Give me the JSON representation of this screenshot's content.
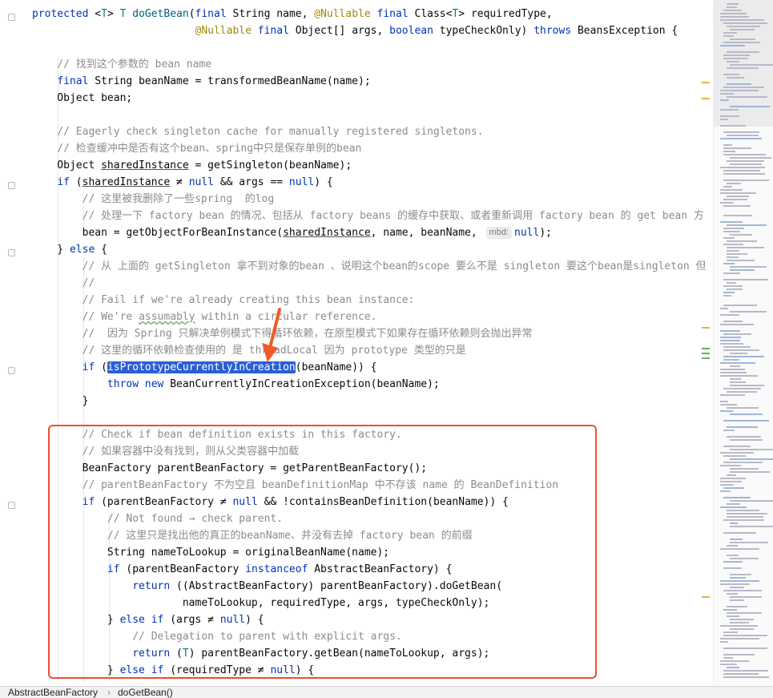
{
  "editor": {
    "lines": [
      {
        "seg": [
          {
            "t": "protected ",
            "c": "kw"
          },
          {
            "t": "<"
          },
          {
            "t": "T",
            "c": "tp"
          },
          {
            "t": "> "
          },
          {
            "t": "T",
            "c": "tp"
          },
          {
            "t": " "
          },
          {
            "t": "doGetBean",
            "c": "fn"
          },
          {
            "t": "("
          },
          {
            "t": "final ",
            "c": "kw"
          },
          {
            "t": "String name, "
          },
          {
            "t": "@Nullable ",
            "c": "ann"
          },
          {
            "t": "final ",
            "c": "kw"
          },
          {
            "t": "Class<"
          },
          {
            "t": "T",
            "c": "tp"
          },
          {
            "t": "> requiredType,"
          }
        ]
      },
      {
        "seg": [
          {
            "t": "                          "
          },
          {
            "t": "@Nullable ",
            "c": "ann"
          },
          {
            "t": "final ",
            "c": "kw"
          },
          {
            "t": "Object[] args, "
          },
          {
            "t": "boolean ",
            "c": "kw"
          },
          {
            "t": "typeCheckOnly) "
          },
          {
            "t": "throws ",
            "c": "kw"
          },
          {
            "t": "BeansException {"
          }
        ]
      },
      {
        "seg": []
      },
      {
        "seg": [
          {
            "t": "    // 找到这个参数的 bean name",
            "c": "cm"
          }
        ]
      },
      {
        "seg": [
          {
            "t": "    "
          },
          {
            "t": "final ",
            "c": "kw"
          },
          {
            "t": "String beanName = transformedBeanName(name);"
          }
        ]
      },
      {
        "seg": [
          {
            "t": "    Object bean;"
          }
        ]
      },
      {
        "seg": []
      },
      {
        "seg": [
          {
            "t": "    // Eagerly check singleton cache for manually registered singletons.",
            "c": "cm"
          }
        ]
      },
      {
        "seg": [
          {
            "t": "    // 检查缓冲中是否有这个bean、spring中只是保存单例的bean",
            "c": "cm"
          }
        ]
      },
      {
        "seg": [
          {
            "t": "    Object "
          },
          {
            "t": "sharedInstance",
            "c": "und"
          },
          {
            "t": " = getSingleton(beanName);"
          }
        ]
      },
      {
        "seg": [
          {
            "t": "    "
          },
          {
            "t": "if ",
            "c": "kw"
          },
          {
            "t": "("
          },
          {
            "t": "sharedInstance",
            "c": "und"
          },
          {
            "t": " ≠ "
          },
          {
            "t": "null ",
            "c": "kw"
          },
          {
            "t": "&& args == "
          },
          {
            "t": "null",
            "c": "kw"
          },
          {
            "t": ") {"
          }
        ]
      },
      {
        "seg": [
          {
            "t": "        // 这里被我删除了一些spring  的log",
            "c": "cm"
          }
        ]
      },
      {
        "seg": [
          {
            "t": "        // 处理一下 factory bean 的情况、包括从 factory beans 的缓存中获取、或者重新调用 factory bean 的 get bean 方",
            "c": "cm"
          }
        ]
      },
      {
        "seg": [
          {
            "t": "        bean = getObjectForBeanInstance("
          },
          {
            "t": "sharedInstance",
            "c": "und"
          },
          {
            "t": ", name, beanName, "
          },
          {
            "t": "mbd:",
            "c": "hint"
          },
          {
            "t": "null",
            "c": "kw"
          },
          {
            "t": ");"
          }
        ]
      },
      {
        "seg": [
          {
            "t": "    } "
          },
          {
            "t": "else ",
            "c": "kw"
          },
          {
            "t": "{"
          }
        ]
      },
      {
        "seg": [
          {
            "t": "        // 从 上面的 getSingleton 拿不到对象的bean 、说明这个bean的scope 要么不是 singleton 要这个bean是singleton 但",
            "c": "cm"
          }
        ]
      },
      {
        "seg": [
          {
            "t": "        //",
            "c": "cm"
          }
        ]
      },
      {
        "seg": [
          {
            "t": "        // Fail if we're already creating this bean instance:",
            "c": "cm"
          }
        ]
      },
      {
        "seg": [
          {
            "t": "        // We're ",
            "c": "cm"
          },
          {
            "t": "assumably",
            "c": "cm wavy"
          },
          {
            "t": " within a circular reference.",
            "c": "cm"
          }
        ]
      },
      {
        "seg": [
          {
            "t": "        //  因为 Spring 只解决单例模式下得循环依赖，在原型模式下如果存在循环依赖则会抛出异常",
            "c": "cm"
          }
        ]
      },
      {
        "seg": [
          {
            "t": "        // 这里的循环依赖检查使用的 是 threadLocal 因为 prototype 类型的只是",
            "c": "cm"
          }
        ]
      },
      {
        "seg": [
          {
            "t": "        "
          },
          {
            "t": "if ",
            "c": "kw"
          },
          {
            "t": "("
          },
          {
            "t": "isPrototypeCurrentlyInCreation",
            "c": "hl"
          },
          {
            "t": "(beanName)) {"
          }
        ]
      },
      {
        "seg": [
          {
            "t": "            "
          },
          {
            "t": "throw new ",
            "c": "kw"
          },
          {
            "t": "BeanCurrentlyInCreationException(beanName);"
          }
        ]
      },
      {
        "seg": [
          {
            "t": "        }"
          }
        ]
      },
      {
        "seg": []
      },
      {
        "seg": [
          {
            "t": "        // Check if bean definition exists in this factory.",
            "c": "cm"
          }
        ]
      },
      {
        "seg": [
          {
            "t": "        // 如果容器中没有找到，则从父类容器中加载",
            "c": "cm"
          }
        ]
      },
      {
        "seg": [
          {
            "t": "        BeanFactory parentBeanFactory = getParentBeanFactory();"
          }
        ]
      },
      {
        "seg": [
          {
            "t": "        // parentBeanFactory 不为空且 beanDefinitionMap 中不存该 name 的 BeanDefinition",
            "c": "cm"
          }
        ]
      },
      {
        "seg": [
          {
            "t": "        "
          },
          {
            "t": "if ",
            "c": "kw"
          },
          {
            "t": "(parentBeanFactory ≠ "
          },
          {
            "t": "null ",
            "c": "kw"
          },
          {
            "t": "&& !containsBeanDefinition(beanName)) {"
          }
        ]
      },
      {
        "seg": [
          {
            "t": "            // Not found → check parent.",
            "c": "cm"
          }
        ]
      },
      {
        "seg": [
          {
            "t": "            // 这里只是找出他的真正的beanName、并没有去掉 factory bean 的前缀",
            "c": "cm"
          }
        ]
      },
      {
        "seg": [
          {
            "t": "            String nameToLookup = originalBeanName(name);"
          }
        ]
      },
      {
        "seg": [
          {
            "t": "            "
          },
          {
            "t": "if ",
            "c": "kw"
          },
          {
            "t": "(parentBeanFactory "
          },
          {
            "t": "instanceof ",
            "c": "kw"
          },
          {
            "t": "AbstractBeanFactory) {"
          }
        ]
      },
      {
        "seg": [
          {
            "t": "                "
          },
          {
            "t": "return ",
            "c": "kw"
          },
          {
            "t": "((AbstractBeanFactory) parentBeanFactory).doGetBean("
          }
        ]
      },
      {
        "seg": [
          {
            "t": "                        nameToLookup, requiredType, args, typeCheckOnly);"
          }
        ]
      },
      {
        "seg": [
          {
            "t": "            } "
          },
          {
            "t": "else if ",
            "c": "kw"
          },
          {
            "t": "(args ≠ "
          },
          {
            "t": "null",
            "c": "kw"
          },
          {
            "t": ") {"
          }
        ]
      },
      {
        "seg": [
          {
            "t": "                // Delegation to parent with explicit args.",
            "c": "cm"
          }
        ]
      },
      {
        "seg": [
          {
            "t": "                "
          },
          {
            "t": "return ",
            "c": "kw"
          },
          {
            "t": "("
          },
          {
            "t": "T",
            "c": "tp"
          },
          {
            "t": ") parentBeanFactory.getBean(nameToLookup, args);"
          }
        ]
      },
      {
        "seg": [
          {
            "t": "            } "
          },
          {
            "t": "else if ",
            "c": "kw"
          },
          {
            "t": "(requiredType ≠ "
          },
          {
            "t": "null",
            "c": "kw"
          },
          {
            "t": ") {"
          }
        ]
      }
    ]
  },
  "statusbar": {
    "crumb_class": "AbstractBeanFactory",
    "crumb_method": "doGetBean()"
  },
  "colors": {
    "highlight_box": "#e8512f",
    "arrow": "#ef5a28",
    "selection": "#2a5fd4"
  }
}
